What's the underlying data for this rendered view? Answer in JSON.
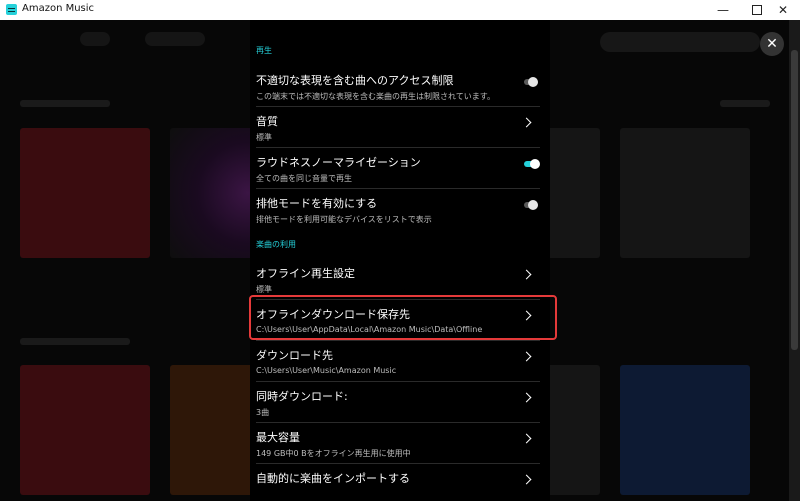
{
  "window": {
    "title": "Amazon Music",
    "minimize": "—",
    "close": "✕"
  },
  "overlay": {
    "close": "✕"
  },
  "sections": {
    "playback": "再生",
    "usage": "楽曲の利用"
  },
  "settings": [
    {
      "title": "不適切な表現を含む曲へのアクセス制限",
      "subtitle": "この端末では不適切な表現を含む楽曲の再生は制限されています。",
      "control": "toggle",
      "state": "off"
    },
    {
      "title": "音質",
      "subtitle": "標準",
      "control": "chevron"
    },
    {
      "title": "ラウドネスノーマライゼーション",
      "subtitle": "全ての曲を同じ音量で再生",
      "control": "toggle",
      "state": "on"
    },
    {
      "title": "排他モードを有効にする",
      "subtitle": "排他モードを利用可能なデバイスをリストで表示",
      "control": "toggle",
      "state": "off"
    },
    {
      "title": "オフライン再生設定",
      "subtitle": "標準",
      "control": "chevron"
    },
    {
      "title": "オフラインダウンロード保存先",
      "subtitle": "C:\\Users\\User\\AppData\\Local\\Amazon Music\\Data\\Offline",
      "control": "chevron",
      "highlighted": true
    },
    {
      "title": "ダウンロード先",
      "subtitle": "C:\\Users\\User\\Music\\Amazon Music",
      "control": "chevron"
    },
    {
      "title": "同時ダウンロード:",
      "subtitle": "3曲",
      "control": "chevron"
    },
    {
      "title": "最大容量",
      "subtitle": "149 GB中0 Bをオフライン再生用に使用中",
      "control": "chevron"
    },
    {
      "title": "自動的に楽曲をインポートする",
      "subtitle": "",
      "control": "chevron"
    }
  ],
  "colors": {
    "accent": "#25d1da",
    "highlight": "#e53a3a"
  }
}
